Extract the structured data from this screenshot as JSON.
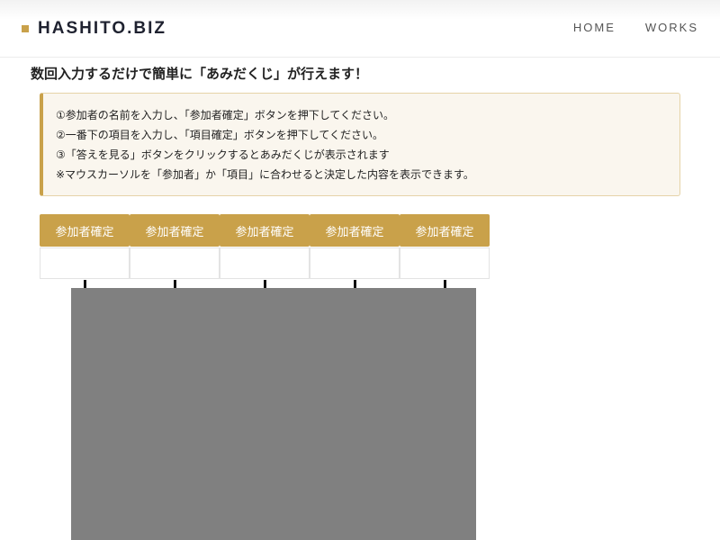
{
  "colors": {
    "accent": "#c9a14a",
    "notice_bg": "#faf6ee",
    "cover": "#808080"
  },
  "header": {
    "brand": "HASHITO.BIZ",
    "nav": [
      "HOME",
      "WORKS"
    ]
  },
  "lead": "数回入力するだけで簡単に「あみだくじ」が行えます！",
  "instructions": [
    "①参加者の名前を入力し、「参加者確定」ボタンを押下してください。",
    "②一番下の項目を入力し、「項目確定」ボタンを押下してください。",
    "③「答えを見る」ボタンをクリックするとあみだくじが表示されます",
    "※マウスカーソルを「参加者」か「項目」に合わせると決定した内容を表示できます。"
  ],
  "participants": [
    {
      "button": "参加者確定",
      "value": "",
      "placeholder": ""
    },
    {
      "button": "参加者確定",
      "value": "",
      "placeholder": ""
    },
    {
      "button": "参加者確定",
      "value": "",
      "placeholder": ""
    },
    {
      "button": "参加者確定",
      "value": "",
      "placeholder": ""
    },
    {
      "button": "参加者確定",
      "value": "",
      "placeholder": ""
    }
  ]
}
